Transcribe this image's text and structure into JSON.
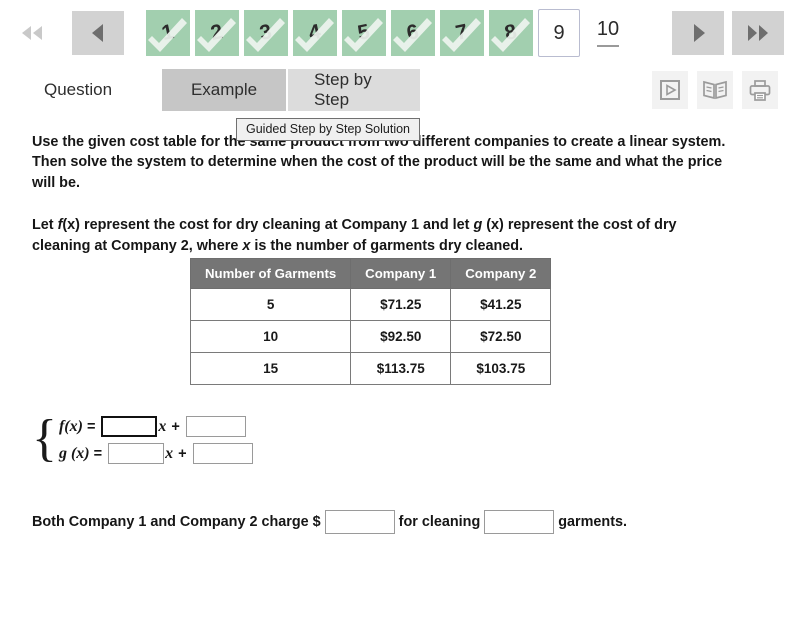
{
  "pager": {
    "first_label": "first-page",
    "prev_label": "previous-page",
    "next_label": "next-page",
    "last_label": "last-page",
    "pages": [
      {
        "number": "1",
        "state": "done"
      },
      {
        "number": "2",
        "state": "done"
      },
      {
        "number": "3",
        "state": "done"
      },
      {
        "number": "4",
        "state": "done"
      },
      {
        "number": "5",
        "state": "done"
      },
      {
        "number": "6",
        "state": "done"
      },
      {
        "number": "7",
        "state": "done"
      },
      {
        "number": "8",
        "state": "done"
      },
      {
        "number": "9",
        "state": "current"
      },
      {
        "number": "10",
        "state": "pending"
      }
    ],
    "done_color": "#a2cfaf",
    "nav_bg_color": "#d2d2d2"
  },
  "tabs": [
    {
      "label": "Question",
      "style": "plain"
    },
    {
      "label": "Example",
      "style": "hovered"
    },
    {
      "label": "Step by Step",
      "style": "normal"
    }
  ],
  "tools": [
    {
      "name": "video-icon"
    },
    {
      "name": "ebook-icon"
    },
    {
      "name": "print-icon"
    }
  ],
  "tooltip": {
    "text": "Guided Step by Step Solution"
  },
  "content": {
    "intro": "Use the given cost table for the same product from two different companies to create a linear system. Then solve the system to determine when the cost of the product will be the same and what the price will be.",
    "define_parts": {
      "p1": "Let ",
      "f": "f",
      "fx": "(x)",
      "p2": " represent the cost for dry cleaning at Company 1 and let ",
      "g": "g",
      "gx": " (x)",
      "p3": " represent the cost of dry cleaning at Company 2, where ",
      "x": "x",
      "p4": " is the number of garments dry cleaned."
    }
  },
  "table": {
    "headers": [
      "Number of Garments",
      "Company 1",
      "Company 2"
    ],
    "rows": [
      [
        "5",
        "$71.25",
        "$41.25"
      ],
      [
        "10",
        "$92.50",
        "$72.50"
      ],
      [
        "15",
        "$113.75",
        "$103.75"
      ]
    ],
    "header_bg": "#757575"
  },
  "system": {
    "brace": "{",
    "rows": [
      {
        "label_fn": "f",
        "label_arg": "(x)",
        "equals": "=",
        "slope_value": "",
        "var": "x",
        "plus": "+",
        "intercept_value": "",
        "focused": true
      },
      {
        "label_fn": "g",
        "label_arg": " (x)",
        "equals": "=",
        "slope_value": "",
        "var": "x",
        "plus": "+",
        "intercept_value": "",
        "focused": false
      }
    ]
  },
  "final": {
    "part1": "Both Company 1 and Company 2 charge $",
    "price_value": "",
    "part2": "for cleaning",
    "qty_value": "",
    "part3": "garments."
  }
}
